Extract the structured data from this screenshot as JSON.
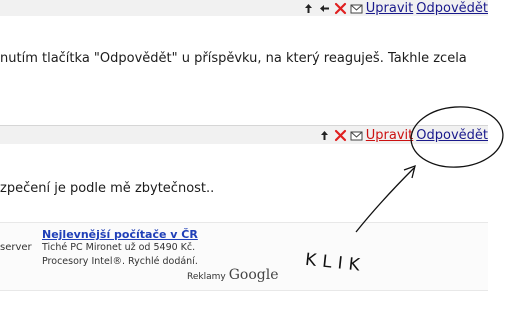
{
  "posts": [
    {
      "toolbar": {
        "edit_label": "Upravit",
        "reply_label": "Odpovědět",
        "edit_active": false
      },
      "text": "nutím tlačítka \"Odpovědět\" u příspěvku, na který reaguješ. Takhle zcela"
    },
    {
      "toolbar": {
        "edit_label": "Upravit",
        "reply_label": "Odpovědět",
        "edit_active": true
      },
      "text": "zpečení je podle mě zbytečnost.."
    }
  ],
  "ad": {
    "left_text": "server",
    "title": "Nejlevnější počítače v ČR",
    "line1": "Tiché PC Mironet už od 5490 Kč.",
    "line2": "Procesory Intel®. Rychlé dodání.",
    "credit_label": "Reklamy",
    "credit_brand": "Google"
  },
  "annotation": {
    "handwritten_text": "KLIK"
  },
  "colors": {
    "link": "#1a1a8c",
    "edit_active": "#cc1111",
    "ad_title": "#1f3fb8",
    "close_icon": "#e02020"
  }
}
